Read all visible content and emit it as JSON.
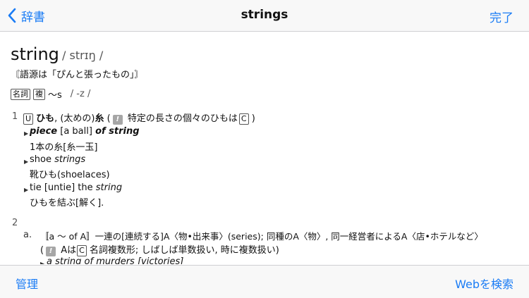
{
  "navbar": {
    "back_label": "辞書",
    "title": "strings",
    "done_label": "完了"
  },
  "entry": {
    "headword": "string",
    "pronunciation": "/ strɪŋ /",
    "etymology": "〘語源は「ぴんと張ったもの」〙",
    "pos_label": "名詞",
    "plural_box": "複",
    "plural_form": "〜s",
    "plural_pron": "/ -z /",
    "sense1": {
      "num": "1",
      "u_box": "U",
      "gloss_bold": "ひも",
      "gloss_rest": ", (太めの)",
      "gloss_bold2": "糸",
      "note_open": " (",
      "note_icon": "!",
      "note_text": " 特定の長さの個々のひもは",
      "c_box": "C",
      "note_close": " )",
      "examples": [
        {
          "en_a": "piece",
          "en_b": " [a ball] ",
          "en_c": "of string",
          "ja": "1本の糸[糸一玉]"
        },
        {
          "en_a": "shoe ",
          "en_b": "strings",
          "en_c": "",
          "ja": "靴ひも(shoelaces)"
        },
        {
          "en_a": "tie [untie] the ",
          "en_b": "string",
          "en_c": "",
          "ja": "ひもを結ぶ[解く]."
        }
      ]
    },
    "sense2": {
      "num": "2",
      "sub": "a.",
      "def_line": "〚a 〜 of A〛一連の[連続する]A〈物•出来事〉(series); 同種のA〈物〉, 同一経営者によるA〈店•ホテルなど〉",
      "note_open": "(",
      "note_icon": "!",
      "note_a": " Aは",
      "c_box": "C",
      "note_b": " 名詞複数形; しばしば単数扱い, 時に複数扱い)",
      "example": "a string of murders [victories]"
    }
  },
  "toolbar": {
    "manage_label": "管理",
    "web_label": "Webを検索"
  }
}
